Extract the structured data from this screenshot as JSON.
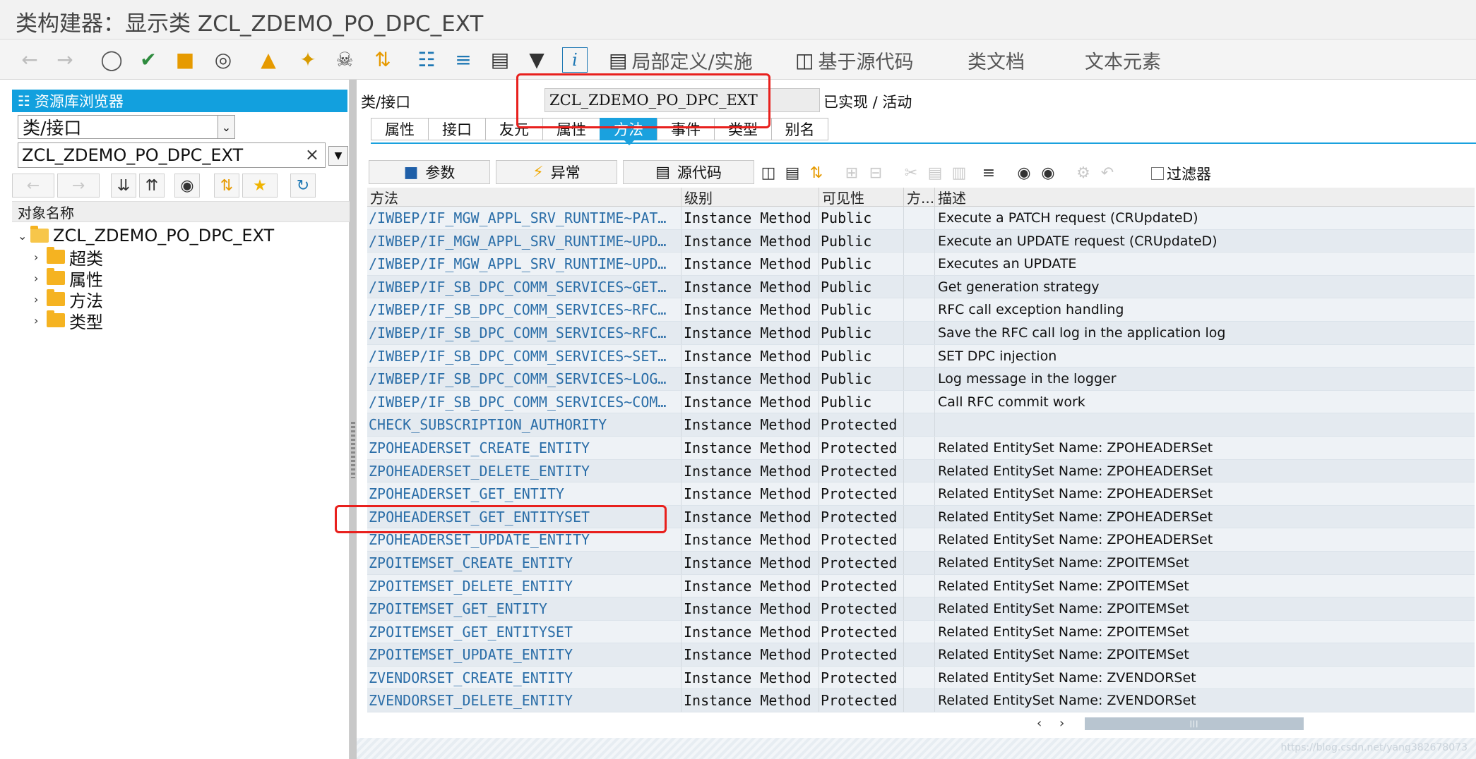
{
  "window": {
    "title": "类构建器：显示类 ZCL_ZDEMO_PO_DPC_EXT"
  },
  "toolbar": {
    "items": [
      {
        "icon": "back-arrow-icon",
        "glyph": "←"
      },
      {
        "icon": "forward-arrow-icon",
        "glyph": "→"
      }
    ],
    "local_def_label": "局部定义/实施",
    "source_based_label": "基于源代码",
    "class_doc_label": "类文档",
    "text_elements_label": "文本元素"
  },
  "left": {
    "repo_browser_title": "资源库浏览器",
    "object_type": "类/接口",
    "object_name": "ZCL_ZDEMO_PO_DPC_EXT",
    "clear_glyph": "×",
    "object_name_header": "对象名称",
    "tree": {
      "root": "ZCL_ZDEMO_PO_DPC_EXT",
      "children": [
        "超类",
        "属性",
        "方法",
        "类型"
      ]
    }
  },
  "class_header": {
    "label": "类/接口",
    "value": "ZCL_ZDEMO_PO_DPC_EXT",
    "status": "已实现 / 活动"
  },
  "tabs": [
    "属性",
    "接口",
    "友元",
    "属性",
    "方法",
    "事件",
    "类型",
    "别名"
  ],
  "subtoolbar": {
    "params_label": "参数",
    "exceptions_label": "异常",
    "source_label": "源代码",
    "filter_label": "过滤器"
  },
  "grid": {
    "columns": [
      "方法",
      "级别",
      "可见性",
      "方...",
      "描述"
    ],
    "rows": [
      {
        "method": "/IWBEP/IF_MGW_APPL_SRV_RUNTIME~PAT…",
        "level": "Instance Method",
        "visibility": "Public",
        "desc": "Execute a PATCH request (CRUpdateD)"
      },
      {
        "method": "/IWBEP/IF_MGW_APPL_SRV_RUNTIME~UPD…",
        "level": "Instance Method",
        "visibility": "Public",
        "desc": "Execute an UPDATE request (CRUpdateD)"
      },
      {
        "method": "/IWBEP/IF_MGW_APPL_SRV_RUNTIME~UPD…",
        "level": "Instance Method",
        "visibility": "Public",
        "desc": "Executes an UPDATE"
      },
      {
        "method": "/IWBEP/IF_SB_DPC_COMM_SERVICES~GET…",
        "level": "Instance Method",
        "visibility": "Public",
        "desc": "Get generation strategy"
      },
      {
        "method": "/IWBEP/IF_SB_DPC_COMM_SERVICES~RFC…",
        "level": "Instance Method",
        "visibility": "Public",
        "desc": "RFC call exception handling"
      },
      {
        "method": "/IWBEP/IF_SB_DPC_COMM_SERVICES~RFC…",
        "level": "Instance Method",
        "visibility": "Public",
        "desc": "Save the RFC call log in the application log"
      },
      {
        "method": "/IWBEP/IF_SB_DPC_COMM_SERVICES~SET…",
        "level": "Instance Method",
        "visibility": "Public",
        "desc": "SET DPC injection"
      },
      {
        "method": "/IWBEP/IF_SB_DPC_COMM_SERVICES~LOG…",
        "level": "Instance Method",
        "visibility": "Public",
        "desc": "Log message in the logger"
      },
      {
        "method": "/IWBEP/IF_SB_DPC_COMM_SERVICES~COM…",
        "level": "Instance Method",
        "visibility": "Public",
        "desc": "Call RFC commit work"
      },
      {
        "method": "CHECK_SUBSCRIPTION_AUTHORITY",
        "level": "Instance Method",
        "visibility": "Protected",
        "desc": ""
      },
      {
        "method": "ZPOHEADERSET_CREATE_ENTITY",
        "level": "Instance Method",
        "visibility": "Protected",
        "desc": "Related EntitySet Name: ZPOHEADERSet"
      },
      {
        "method": "ZPOHEADERSET_DELETE_ENTITY",
        "level": "Instance Method",
        "visibility": "Protected",
        "desc": "Related EntitySet Name: ZPOHEADERSet"
      },
      {
        "method": "ZPOHEADERSET_GET_ENTITY",
        "level": "Instance Method",
        "visibility": "Protected",
        "desc": "Related EntitySet Name: ZPOHEADERSet"
      },
      {
        "method": "ZPOHEADERSET_GET_ENTITYSET",
        "level": "Instance Method",
        "visibility": "Protected",
        "desc": "Related EntitySet Name: ZPOHEADERSet"
      },
      {
        "method": "ZPOHEADERSET_UPDATE_ENTITY",
        "level": "Instance Method",
        "visibility": "Protected",
        "desc": "Related EntitySet Name: ZPOHEADERSet"
      },
      {
        "method": "ZPOITEMSET_CREATE_ENTITY",
        "level": "Instance Method",
        "visibility": "Protected",
        "desc": "Related EntitySet Name: ZPOITEMSet"
      },
      {
        "method": "ZPOITEMSET_DELETE_ENTITY",
        "level": "Instance Method",
        "visibility": "Protected",
        "desc": "Related EntitySet Name: ZPOITEMSet"
      },
      {
        "method": "ZPOITEMSET_GET_ENTITY",
        "level": "Instance Method",
        "visibility": "Protected",
        "desc": "Related EntitySet Name: ZPOITEMSet"
      },
      {
        "method": "ZPOITEMSET_GET_ENTITYSET",
        "level": "Instance Method",
        "visibility": "Protected",
        "desc": "Related EntitySet Name: ZPOITEMSet"
      },
      {
        "method": "ZPOITEMSET_UPDATE_ENTITY",
        "level": "Instance Method",
        "visibility": "Protected",
        "desc": "Related EntitySet Name: ZPOITEMSet"
      },
      {
        "method": "ZVENDORSET_CREATE_ENTITY",
        "level": "Instance Method",
        "visibility": "Protected",
        "desc": "Related EntitySet Name: ZVENDORSet"
      },
      {
        "method": "ZVENDORSET_DELETE_ENTITY",
        "level": "Instance Method",
        "visibility": "Protected",
        "desc": "Related EntitySet Name: ZVENDORSet"
      }
    ]
  },
  "scrollbar": {
    "left_glyph": "‹",
    "right_glyph": "›",
    "thumb_grip": "|||"
  },
  "watermark": "https://blog.csdn.net/yang382678073",
  "colors": {
    "accent": "#1aa1de",
    "highlight_box": "#e8201d",
    "method_link": "#2b6ea8"
  }
}
